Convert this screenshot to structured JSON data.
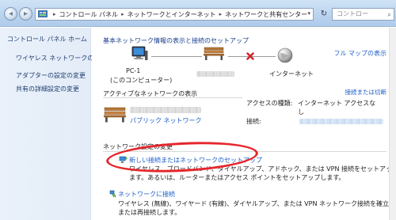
{
  "address": {
    "crumbs": [
      "コントロール パネル",
      "ネットワークとインターネット",
      "ネットワークと共有センター"
    ],
    "separator": "▸",
    "dropdown": "▾",
    "refresh": "↻",
    "search_placeholder": "コントロー"
  },
  "nav": {
    "back": "◂",
    "forward": "▸"
  },
  "sidebar": {
    "home": "コントロール パネル ホーム",
    "tasks": [
      "ワイヤレス ネットワークの管理",
      "アダプターの設定の変更",
      "共有の詳細設定の変更"
    ]
  },
  "main": {
    "heading": "基本ネットワーク情報の表示と接続のセットアップ",
    "full_map": "フル マップの表示",
    "map": {
      "pc_label_1": "PC-1",
      "pc_label_2": "(このコンピューター)",
      "internet_label": "インターネット"
    },
    "active_section": "アクティブなネットワークの表示",
    "disconnect": "接続または切断",
    "network_type": "パブリック ネットワーク",
    "access_type_label": "アクセスの種類:",
    "access_type_value_1": "インターネット アクセスな",
    "access_type_value_2": "し",
    "connections_label": "接続:",
    "change_section": "ネットワーク設定の変更",
    "new_connection_link": "新しい接続またはネットワークのセットアップ",
    "new_connection_desc_1": "ワイヤレス、ブロードバンド、ダイヤルアップ、アドホック、または VPN 接続をセットアップし",
    "new_connection_desc_2": "ます。あるいは、ルーターまたはアクセス ポイントをセットアップします。",
    "connect_link": "ネットワークに接続",
    "connect_desc_1": "ワイヤレス (無線)、ワイヤード (有線)、ダイヤルアップ、または VPN ネットワーク接続を確立",
    "connect_desc_2": "または再接続します。"
  },
  "colors": {
    "link": "#1a5dc9",
    "highlight": "#e5262c",
    "sidebar_text": "#1e3d6e"
  }
}
